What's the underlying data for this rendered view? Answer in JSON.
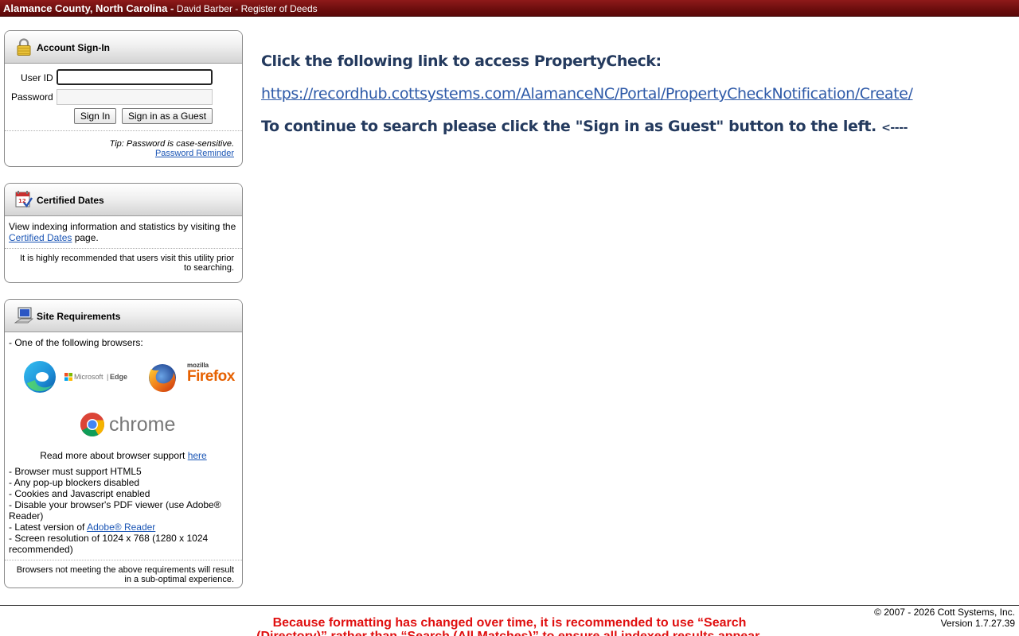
{
  "header": {
    "county": "Alamance County, North Carolina - ",
    "office": "David Barber - Register of Deeds"
  },
  "signin": {
    "title": "Account Sign-In",
    "user_label": "User ID",
    "user_value": "",
    "password_label": "Password",
    "password_value": "",
    "signin_button": "Sign In",
    "guest_button": "Sign in as a Guest",
    "tip": "Tip: Password is case-sensitive.",
    "reminder_link": "Password Reminder"
  },
  "certified": {
    "title": "Certified Dates",
    "text_before": "View indexing information and statistics by visiting the ",
    "link": "Certified Dates",
    "text_after": " page.",
    "footnote": "It is highly recommended that users visit this utility prior to searching."
  },
  "requirements": {
    "title": "Site Requirements",
    "intro": "- One of the following browsers:",
    "browsers": {
      "edge_brand": "Microsoft",
      "edge_name": "Edge",
      "firefox_brand": "mozilla",
      "firefox_name": "Firefox",
      "chrome_name": "chrome"
    },
    "read_more_text": "Read more about browser support ",
    "read_more_link": "here",
    "items": [
      "- Browser must support HTML5",
      "- Any pop-up blockers disabled",
      "- Cookies and Javascript enabled",
      "- Disable your browser's PDF viewer (use Adobe® Reader)"
    ],
    "latest_prefix": "- Latest version of ",
    "latest_link": "Adobe® Reader",
    "resolution": "- Screen resolution of 1024 x 768 (1280 x 1024 recommended)",
    "footnote": "Browsers not meeting the above requirements will result in a sub-optimal experience."
  },
  "main": {
    "line1": "Click the following link to access PropertyCheck:",
    "link": "https://recordhub.cottsystems.com/AlamanceNC/Portal/PropertyCheckNotification/Create/",
    "line3": "To continue to search please click the \"Sign in as Guest\" button to the left. ",
    "arrow": "<----"
  },
  "footer": {
    "copyright": "© 2007 - 2026 Cott Systems, Inc.",
    "version": "Version 1.7.27.39",
    "notice": "Because formatting has changed over time, it is recommended to use “Search (Directory)” rather than “Search (All Matches)” to ensure all indexed results appear."
  },
  "icons": {
    "signin": "lock-icon",
    "certified": "calendar-check-icon",
    "requirements": "computer-icon"
  },
  "colors": {
    "topbar": "#6b0d0d",
    "main_text": "#243a5e",
    "link": "#1a55b5",
    "notice": "#e01010"
  }
}
